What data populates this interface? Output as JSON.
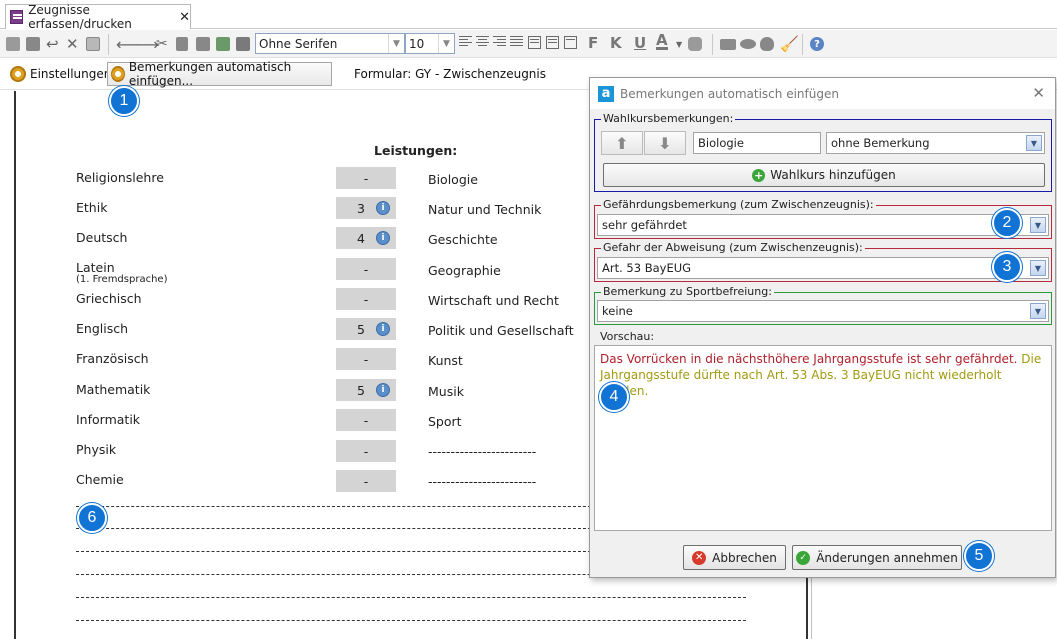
{
  "tab": {
    "title": "Zeugnisse erfassen/drucken",
    "close": "✕"
  },
  "toolbar": {
    "font_name": "Ohne Serifen",
    "font_size": "10",
    "bold": "F",
    "italic": "K",
    "underline": "U",
    "font_color": "A"
  },
  "toolbar2": {
    "settings_label": "Einstellungen",
    "auto_remarks_label": "Bemerkungen automatisch einfügen...",
    "form_label": "Formular: GY - Zwischenzeugnis"
  },
  "document": {
    "heading": "Leistungen:",
    "left_subjects": [
      {
        "name": "Religionslehre",
        "grade": "-",
        "info": false
      },
      {
        "name": "Ethik",
        "grade": "3",
        "info": true
      },
      {
        "name": "Deutsch",
        "grade": "4",
        "info": true
      },
      {
        "name": "Latein",
        "note": "(1. Fremdsprache)",
        "grade": "-",
        "info": false
      },
      {
        "name": "Griechisch",
        "grade": "-",
        "info": false
      },
      {
        "name": "Englisch",
        "grade": "5",
        "info": true
      },
      {
        "name": "Französisch",
        "grade": "-",
        "info": false
      },
      {
        "name": "Mathematik",
        "grade": "5",
        "info": true
      },
      {
        "name": "Informatik",
        "grade": "-",
        "info": false
      },
      {
        "name": "Physik",
        "grade": "-",
        "info": false
      },
      {
        "name": "Chemie",
        "grade": "-",
        "info": false
      }
    ],
    "right_subjects": [
      "Biologie",
      "Natur und Technik",
      "Geschichte",
      "Geographie",
      "Wirtschaft und Recht",
      "Politik und Gesellschaft",
      "Kunst",
      "Musik",
      "Sport",
      "------------------------",
      "------------------------"
    ]
  },
  "dialog": {
    "title": "Bemerkungen automatisch einfügen",
    "elective_group": {
      "label": "Wahlkursbemerkungen:",
      "up": "⬆",
      "down": "⬇",
      "course_value": "Biologie",
      "remark_value": "ohne Bemerkung",
      "add_button": "Wahlkurs hinzufügen"
    },
    "risk_group": {
      "label": "Gefährdungsbemerkung (zum Zwischenzeugnis):",
      "value": "sehr gefährdet"
    },
    "rejection_group": {
      "label": "Gefahr der Abweisung (zum Zwischenzeugnis):",
      "value": "Art. 53 BayEUG"
    },
    "sport_group": {
      "label": "Bemerkung zu Sportbefreiung:",
      "value": "keine"
    },
    "preview": {
      "label": "Vorschau:",
      "text_red": "Das Vorrücken in die nächsthöhere Jahrgangsstufe ist sehr gefährdet.",
      "text_olive": "Die Jahrgangsstufe dürfte nach Art. 53 Abs. 3 BayEUG nicht wiederholt werden."
    },
    "cancel_button": "Abbrechen",
    "accept_button": "Änderungen annehmen"
  },
  "callouts": [
    "1",
    "2",
    "3",
    "4",
    "5",
    "6"
  ],
  "colors": {
    "accent_blue": "#1173d4",
    "border_blue": "#1a1aa8",
    "border_red": "#b42a3a",
    "border_green": "#2a9a3a",
    "preview_red": "#b0202a",
    "preview_olive": "#a29a10"
  }
}
